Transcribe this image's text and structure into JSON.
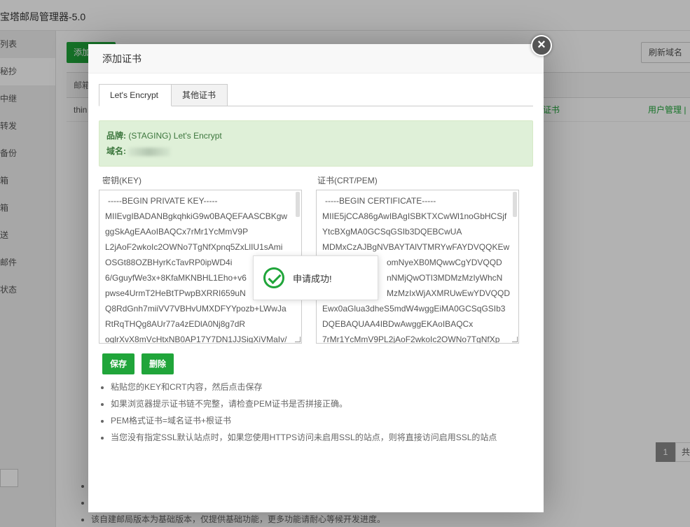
{
  "background": {
    "app_title": "宝塔邮局管理器-5.0",
    "sidebar": [
      "列表",
      "秘抄",
      "中继",
      "转发",
      "备份",
      "箱",
      "箱",
      "送",
      "邮件",
      "状态"
    ],
    "add_button": "添加",
    "refresh_button": "刷新域名",
    "table_header": "邮箱",
    "table_row_text": "thin",
    "table_row_link1": "证书",
    "table_row_link2": "用户管理 |",
    "pager_page": "1",
    "pager_text": "共",
    "notes": [
      "",
      "",
      "该自建邮局版本为基础版本，仅提供基础功能，更多功能请耐心等候开发进度。"
    ]
  },
  "dialog": {
    "title": "添加证书",
    "close_icon": "close-icon",
    "tabs": [
      {
        "label": "Let's Encrypt",
        "active": true
      },
      {
        "label": "其他证书",
        "active": false
      }
    ],
    "info": {
      "brand_label": "品牌:",
      "brand_value": " (STAGING) Let's Encrypt",
      "domain_label": "域名:"
    },
    "key_label": "密钥(KEY)",
    "cert_label": "证书(CRT/PEM)",
    "key_lines": [
      "-----BEGIN PRIVATE KEY-----",
      "MIIEvgIBADANBgkqhkiG9w0BAQEFAASCBKgw",
      "ggSkAgEAAoIBAQCx7rMr1YcMmV9P",
      "L2jAoF2wkoIc2OWNo7TgNfXpnq5ZxLlIU1sAmi",
      "OSGt88OZBHyrKcTavRP0ipWD4i",
      "6/GguyfWe3x+8KfaMKNBHL1Eho+v6",
      "pwse4UrmT2HeBtTPwpBXRRI659uN",
      "Q8RdGnh7miiVV7VBHvUMXDFYYpozb+LWwJa",
      "RtRqTHQg8AUr77a4zEDlA0Nj8g7dR",
      "oqlrXvX8mVcHtxNB0AP17Y7DN1JJSigXiVMaIv/"
    ],
    "cert_lines": [
      "-----BEGIN CERTIFICATE-----",
      "MIIE5jCCA86gAwIBAgISBKTXCwWl1noGbHCSjf",
      "YtcBXgMA0GCSqGSIb3DQEBCwUA",
      "MDMxCzAJBgNVBAYTAlVTMRYwFAYDVQQKEw",
      "omNyeXB0MQwwCgYDVQQD",
      "nNMjQwOTI3MDMzMzIyWhcN",
      "MzMzIxWjAXMRUwEwYDVQQD",
      "Ewx0aGlua3dheS5mdW4wggEiMA0GCSqGSIb3",
      "DQEBAQUAA4IBDwAwggEKAoIBAQCx",
      "7rMr1YcMmV9PL2jAoF2wkoIc2OWNo7TgNfXp"
    ],
    "save_button": "保存",
    "delete_button": "删除",
    "tips": [
      "粘贴您的KEY和CRT内容，然后点击保存",
      "如果浏览器提示证书链不完整，请检查PEM证书是否拼接正确。",
      "PEM格式证书=域名证书+根证书",
      "当您没有指定SSL默认站点时，如果您使用HTTPS访问未启用SSL的站点，则将直接访问启用SSL的站点"
    ]
  },
  "toast": {
    "icon": "check-circle-icon",
    "text": "申请成功!"
  },
  "colors": {
    "accent": "#20a53a",
    "info_bg": "#dff0d8",
    "info_text": "#3c763d"
  }
}
